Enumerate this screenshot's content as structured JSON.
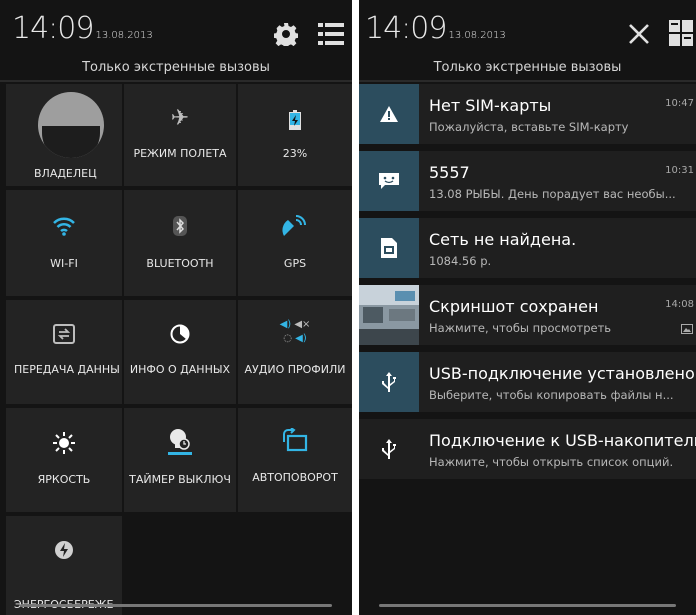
{
  "left_panel": {
    "time": "14:09",
    "date": "13.08.2013",
    "emergency_text": "Только экстренные вызовы",
    "tiles": {
      "owner": "ВЛАДЕЛЕЦ",
      "airplane": "РЕЖИМ ПОЛЕТА",
      "battery": "23%",
      "wifi": "WI-FI",
      "bluetooth": "BLUETOOTH",
      "gps": "GPS",
      "data_transfer": "ПЕРЕДАЧА ДАННЫ",
      "data_info": "ИНФО О ДАННЫХ",
      "audio_profiles": "АУДИО ПРОФИЛИ",
      "brightness": "ЯРКОСТЬ",
      "sleep_timer": "ТАЙМЕР ВЫКЛЮЧ",
      "autorotate": "АВТОПОВОРОТ",
      "power_saving": "ЭНЕРГОСБЕРЕЖЕ"
    }
  },
  "right_panel": {
    "time": "14:09",
    "date": "13.08.2013",
    "emergency_text": "Только экстренные вызовы",
    "notifications": [
      {
        "title": "Нет SIM-карты",
        "subtitle": "Пожалуйста, вставьте SIM-карту",
        "time": "10:47",
        "icon": "warning-icon"
      },
      {
        "title": "5557",
        "subtitle": "13.08 РЫБЫ. День порадует вас необы...",
        "time": "10:31",
        "icon": "message-icon"
      },
      {
        "title": "Сеть не найдена.",
        "subtitle": "1084.56 р.",
        "time": "",
        "icon": "sim-icon"
      },
      {
        "title": "Скриншот сохранен",
        "subtitle": "Нажмите, чтобы просмотреть",
        "time": "14:08",
        "icon": "screenshot-thumbnail"
      },
      {
        "title": "USB-подключение установлено",
        "subtitle": "Выберите, чтобы копировать файлы н...",
        "time": "",
        "icon": "usb-icon"
      },
      {
        "title": "Подключение к USB-накопителю",
        "subtitle": "Нажмите, чтобы открыть список опций.",
        "time": "",
        "icon": "usb-icon"
      }
    ]
  },
  "colors": {
    "accent": "#33b5e5",
    "tile_bg": "#232323",
    "icon_box": "#2c4d5e",
    "panel_bg": "#141414"
  }
}
